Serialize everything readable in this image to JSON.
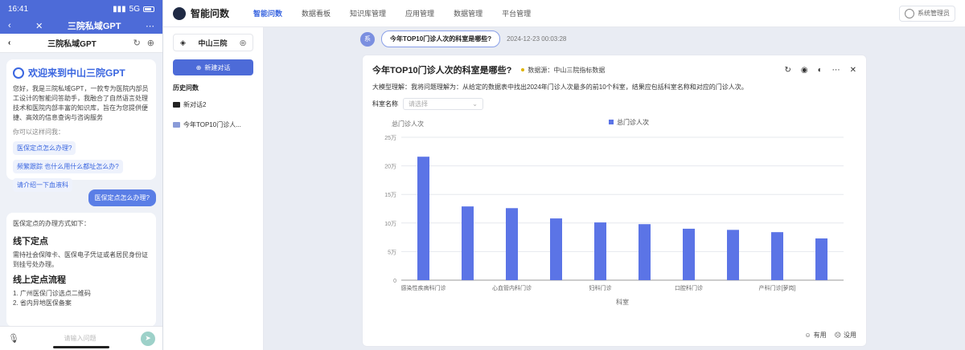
{
  "phone": {
    "time": "16:41",
    "network": "5G",
    "title": "三院私域GPT",
    "subtitle": "三院私域GPT",
    "welcome_title": "欢迎来到中山三院GPT",
    "welcome_body": "您好，我是三院私域GPT，一款专为医院内部员工设计的智能问答助手，我融合了自然语言处理技术和医院内部丰富的知识库，旨在为您提供便捷、高效的信息查询与咨询服务",
    "hint_label": "你可以这样问我：",
    "suggestions": [
      "医保定点怎么办理?",
      "频繁跟踪 也什么用什么都址怎么办?",
      "请介绍一下血液科"
    ],
    "user_question": "医保定点怎么办理?",
    "answer_intro": "医保定点的办理方式如下：",
    "answer_h1": "线下定点",
    "answer_p1": "需持社会保障卡、医保电子凭证或者居民身份证到挂号处办理。",
    "answer_h2": "线上定点流程",
    "answer_li1": "1. 广州医保门诊选点二维码",
    "answer_li2": "2. 省内异地医保备案",
    "input_placeholder": "请输入问题"
  },
  "desktop": {
    "brand": "智能问数",
    "nav": [
      "智能问数",
      "数据看板",
      "知识库管理",
      "应用管理",
      "数据管理",
      "平台管理"
    ],
    "user": "系统管理员",
    "org": "中山三院",
    "new_chat": "新建对话",
    "history_label": "历史问数",
    "history": [
      "新对话2",
      "今年TOP10门诊人..."
    ],
    "question_avatar": "系",
    "question": "今年TOP10门诊人次的科室是哪些?",
    "question_time": "2024-12-23 00:03:28",
    "card_title": "今年TOP10门诊人次的科室是哪些?",
    "source": "数据源：中山三院指标数据",
    "understanding": "大模型理解：我将问题理解为：从给定的数据表中找出2024年门诊人次最多的前10个科室，结果应包括科室名称和对应的门诊人次。",
    "filter_label": "科室名称",
    "filter_placeholder": "请选择",
    "feedback_yes": "有用",
    "feedback_no": "没用"
  },
  "colors": {
    "primary": "#4d6bd8",
    "bar": "#5b74e6"
  },
  "chart_data": {
    "type": "bar",
    "ylabel": "总门诊人次",
    "xlabel": "科室",
    "legend": "总门诊人次",
    "ylim": [
      0,
      250000
    ],
    "yticks": [
      "0",
      "5万",
      "10万",
      "15万",
      "20万",
      "25万"
    ],
    "xtick_labels": [
      "感染性疾病科门诊",
      "心血管内科门诊",
      "妇科门诊",
      "口腔科门诊",
      "产科门诊[萝岗]"
    ],
    "xtick_indices": [
      0,
      2,
      4,
      6,
      8
    ],
    "values": [
      216000,
      129000,
      126000,
      108000,
      101000,
      98000,
      90000,
      88000,
      84000,
      73000
    ]
  }
}
